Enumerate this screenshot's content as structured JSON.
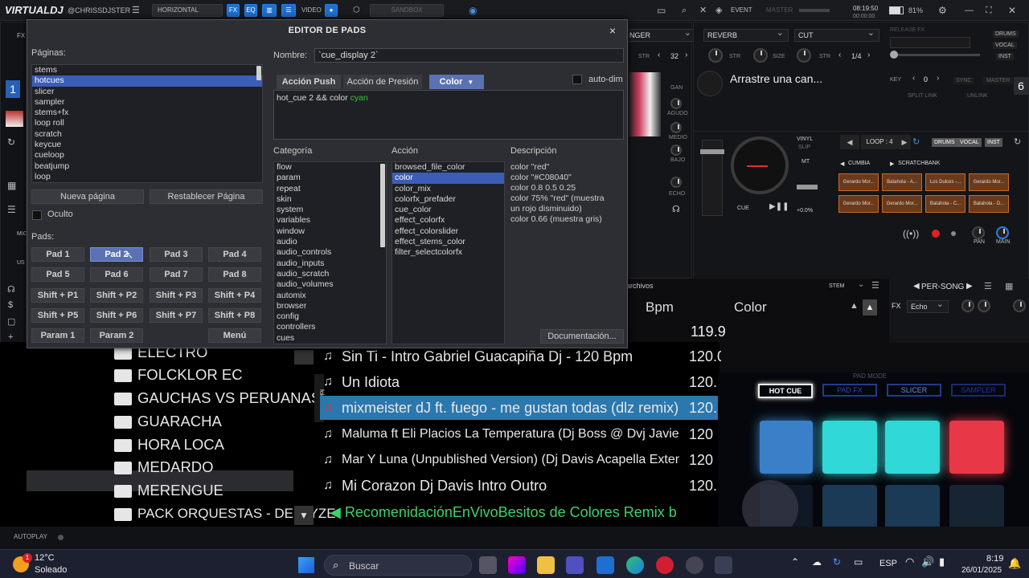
{
  "topbar": {
    "logo": "VIRTUALDJ",
    "user": "@CHRISSDJSTER",
    "layout": "HORIZONTAL",
    "fx": "FX",
    "eq": "EQ",
    "video": "VIDEO",
    "sandbox": "SANDBOX",
    "event": "EVENT",
    "master": "MASTER",
    "clock": "08:19:50",
    "time_elapsed": "00:00:00",
    "battery": "81%"
  },
  "deck_left": {
    "number": "1",
    "fx_label": "FX",
    "mic_label": "MIC",
    "usb_label": "US"
  },
  "deck_right": {
    "number": "6",
    "track_title": "Arrastre una can...",
    "key_label": "KEY",
    "key_value": "0",
    "sync": "SYNC",
    "master": "MASTER",
    "split_link": "SPLIT LINK",
    "unlink": "UNLINK",
    "release_fx": "RELEASE FX",
    "stems": [
      "DRUMS",
      "VOCAL",
      "INST"
    ],
    "loop_label": "LOOP : 4",
    "pad_page": "CUMBIA",
    "scratchbank": "SCRATCHBANK",
    "cue": "CUE",
    "vinyl": "VINYL",
    "slip": "SLIP",
    "mt": "MT",
    "pitch": "+0.0%",
    "pan": "PAN",
    "main": "MAIN",
    "scratch_pads": [
      "Gerardo Mor...",
      "Batahola - A...",
      "Los Dulces -...",
      "Gerardo Mor...",
      "Gerardo Mor...",
      "Gerardo Mor...",
      "Batahola - C...",
      "Batahola - D..."
    ]
  },
  "mixer": {
    "fx1": "NGER",
    "fx2": "REVERB",
    "fx3": "CUT",
    "str": "STR",
    "size": "SIZE",
    "val1": "32",
    "val2": "1/4",
    "eq": [
      "GAN",
      "AGUDO",
      "MEDIO",
      "BAJO",
      "ECHO"
    ]
  },
  "dialog": {
    "title": "EDITOR DE PADS",
    "close": "×",
    "pages_label": "Páginas:",
    "pages": [
      "stems",
      "hotcues",
      "slicer",
      "sampler",
      "stems+fx",
      "loop roll",
      "scratch",
      "keycue",
      "cueloop",
      "beatjump",
      "loop"
    ],
    "selected_page": 1,
    "new_page": "Nueva página",
    "reset_page": "Restablecer Página",
    "hidden": "Oculto",
    "pads_label": "Pads:",
    "pads": [
      "Pad 1",
      "Pad 2",
      "Pad 3",
      "Pad 4",
      "Pad 5",
      "Pad 6",
      "Pad 7",
      "Pad 8",
      "Shift + P1",
      "Shift + P2",
      "Shift + P3",
      "Shift + P4",
      "Shift + P5",
      "Shift + P6",
      "Shift + P7",
      "Shift + P8",
      "Param 1",
      "Param 2",
      "",
      "Menú"
    ],
    "name_label": "Nombre:",
    "name_value": "`cue_display 2`",
    "tab_push": "Acción Push",
    "tab_pressure": "Acción de Presión",
    "tab_color": "Color",
    "autodim": "auto-dim",
    "script_main": "hot_cue 2 && color ",
    "script_color": "cyan",
    "category_label": "Categoría",
    "categories": [
      "flow",
      "param",
      "repeat",
      "skin",
      "system",
      "variables",
      "window",
      "audio",
      "audio_controls",
      "audio_inputs",
      "audio_scratch",
      "audio_volumes",
      "automix",
      "browser",
      "config",
      "controllers",
      "cues"
    ],
    "action_label": "Acción",
    "actions": [
      "browsed_file_color",
      "color",
      "color_mix",
      "colorfx_prefader",
      "cue_color",
      "effect_colorfx",
      "effect_colorslider",
      "effect_stems_color",
      "filter_selectcolorfx"
    ],
    "selected_action": 1,
    "description_label": "Descripción",
    "description": [
      "color \"red\"",
      "color \"#C08040\"",
      "color 0.8 0.5 0.25",
      "color 75% \"red\" (muestra",
      "un rojo disminuido)",
      "color 0.66 (muestra gris)"
    ],
    "doc_button": "Documentación..."
  },
  "browser": {
    "archivos": "archivos",
    "stem": "STEM",
    "col_bpm": "Bpm",
    "col_color": "Color",
    "first_bpm": "119.9",
    "per_song": "PER-SONG",
    "fx": "FX",
    "fx_value": "Echo",
    "folders_tab": "folders",
    "folders": [
      "ELECTRO",
      "FOLCKLOR EC",
      "GAUCHAS VS PERUANAS",
      "GUARACHA",
      "HORA LOCA",
      "MEDARDO",
      "MERENGUE",
      "PACK ORQUESTAS - DELAYZE"
    ],
    "selected_folder": 6,
    "tracks": [
      {
        "title": "Sin Ti - Intro Gabriel Guacapiña Dj - 120 Bpm",
        "bpm": "120.0"
      },
      {
        "title": "Un Idiota",
        "bpm": "120."
      },
      {
        "title": "mixmeister dJ ft. fuego - me gustan todas (dlz remix)",
        "bpm": "120."
      },
      {
        "title": "Maluma ft Eli Placios   La Temperatura (Dj Boss @ Dvj Javie...",
        "bpm": "120"
      },
      {
        "title": "Mar Y Luna (Unpublished Version) (Dj Davis Acapella Exten...",
        "bpm": "120"
      },
      {
        "title": "Mi Corazon  Dj Davis Intro Outro",
        "bpm": "120."
      }
    ],
    "selected_track": 2,
    "recommendation": "RecomenidaciónEnVivoBesitos de Colores Remix b",
    "autoplay": "AUTOPLAY"
  },
  "controller": {
    "pad_mode": "PAD MODE",
    "modes": [
      "HOT CUE",
      "PAD FX",
      "SLICER",
      "SAMPLER"
    ],
    "pad_colors": [
      "#3a80c8",
      "#30d8d8",
      "#30d8d8",
      "#e83848"
    ]
  },
  "taskbar": {
    "weather_temp": "12°C",
    "weather_desc": "Soleado",
    "search": "Buscar",
    "lang": "ESP",
    "time": "8:19",
    "date": "26/01/2025",
    "notif": "1"
  }
}
